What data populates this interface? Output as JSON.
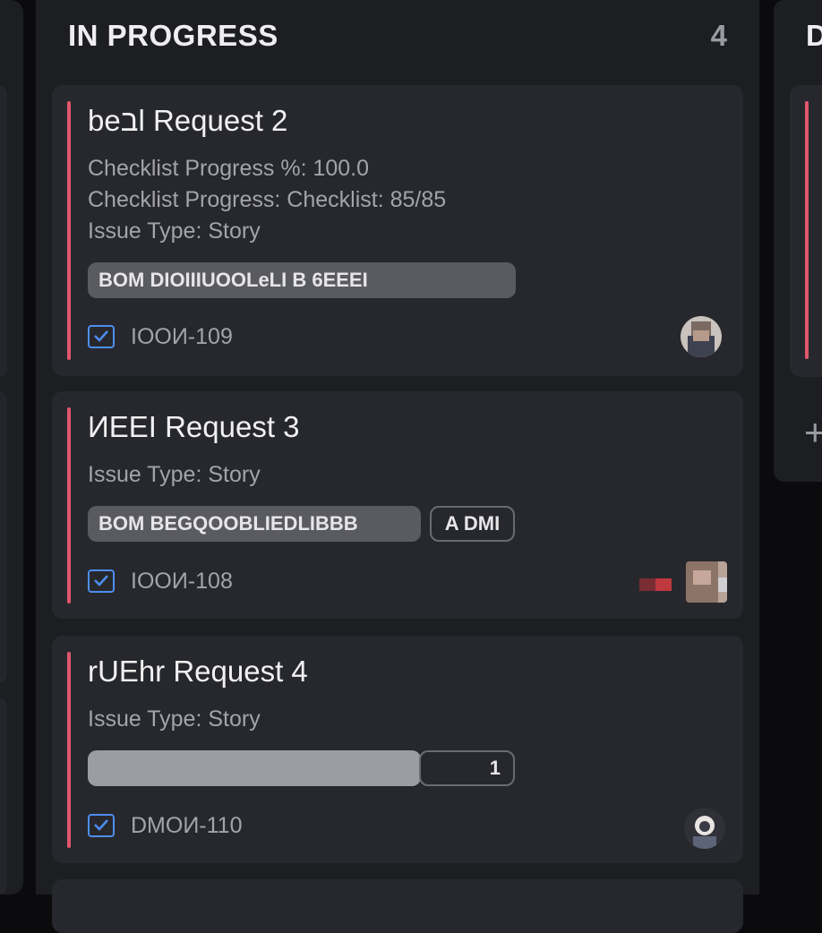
{
  "column": {
    "title": "IN PROGRESS",
    "count": "4"
  },
  "cards": [
    {
      "title": "beבl Request 2",
      "fields": [
        "Checklist Progress %: 100.0",
        "Checklist Progress: Checklist: 85/85",
        "Issue Type: Story"
      ],
      "chip": "BOM DIOIIIUOOLeLI B 6EEEI",
      "chip_extra": "",
      "issue_type_icon": "checkbox-story-icon",
      "key": "IOOИ-109"
    },
    {
      "title": "ИEEI Request 3",
      "fields": [
        "Issue Type: Story"
      ],
      "chip": "BOM BEGQOOBLIEDLIBBB",
      "chip_extra": "A DMI",
      "issue_type_icon": "checkbox-story-icon",
      "key": "IOOИ-108"
    },
    {
      "title": "rUEhr Request 4",
      "fields": [
        "Issue Type: Story"
      ],
      "chip": "",
      "chip_extra": "1",
      "issue_type_icon": "checkbox-story-icon",
      "key": "DMOИ-110"
    }
  ],
  "next_column": {
    "title_fragment": "D"
  },
  "colors": {
    "accent_bar": "#e0576c",
    "story_icon": "#4d8ef0",
    "column_bg": "#1d1e22",
    "card_bg": "#27282d"
  }
}
